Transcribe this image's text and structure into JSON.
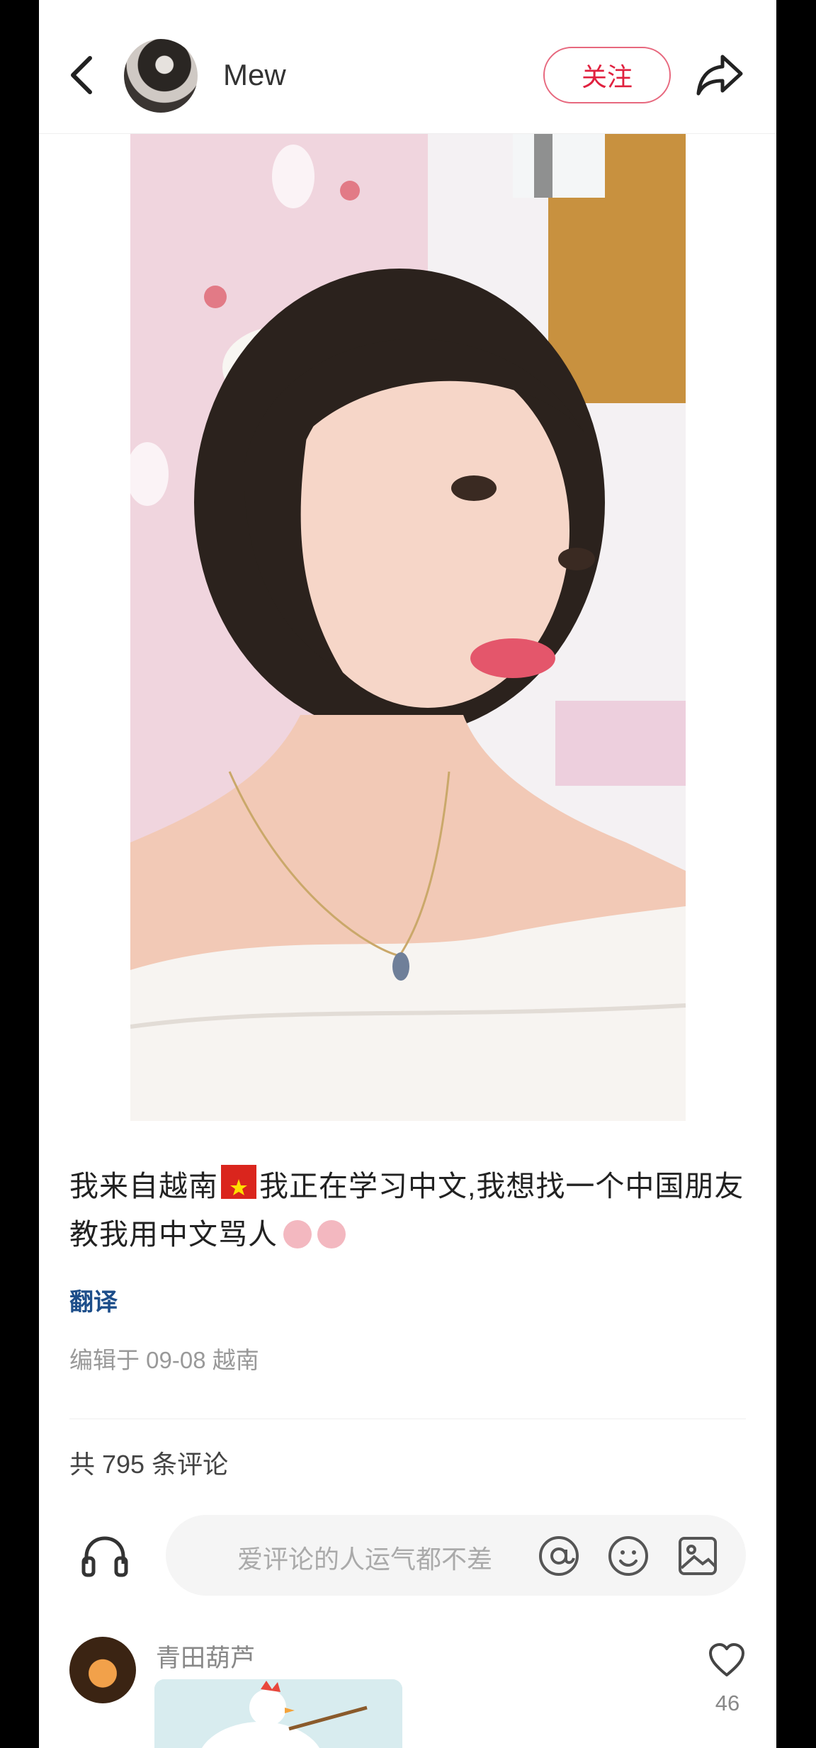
{
  "header": {
    "username": "Mew",
    "follow_label": "关注"
  },
  "post": {
    "caption_part1": "我来自越南",
    "caption_part2": "我正在学习中文,我想找一个中国朋友教我用中文骂人",
    "translate_label": "翻译",
    "meta": "编辑于 09-08 越南"
  },
  "comments": {
    "count_label": "共 795 条评论",
    "input_placeholder": "爱评论的人运气都不差",
    "items": [
      {
        "name": "青田葫芦",
        "likes": "46"
      }
    ]
  },
  "colors": {
    "accent": "#e0213f",
    "link": "#1d4e8a",
    "muted": "#999999"
  },
  "icons": [
    "back-icon",
    "share-icon",
    "headphone-icon",
    "at-icon",
    "emoji-icon",
    "image-icon",
    "heart-icon",
    "vietnam-flag-icon"
  ]
}
